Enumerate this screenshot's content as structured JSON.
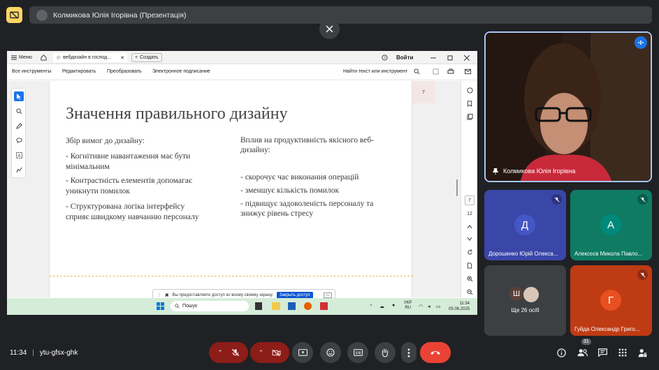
{
  "topbar": {
    "presenter_title": "Колмикова Юлія Ігорівна (Презентація)"
  },
  "colors": {
    "bg": "#202124",
    "accent": "#fdd663",
    "end_call": "#ea4335",
    "slide_text": "#3a3a3a"
  },
  "browser": {
    "menu_label": "Меню",
    "tab_label": "вебдизайн в господ...",
    "new_tab_label": "Создать",
    "login_label": "Войти"
  },
  "pdf_toolbar": {
    "items": [
      "Все инструменты",
      "Редактировать",
      "Преобразовать",
      "Электронное подписание"
    ],
    "search_label": "Найти текст или инструмент"
  },
  "slide": {
    "title": "Значення правильного дизайну",
    "left_heading": "Збір вимог до дизайну:",
    "left_items": [
      [
        "- Когнітивне навантаження має бути",
        "мінімальним"
      ],
      [
        "- Контрастність елементів допомагає",
        "уникнути помилок"
      ],
      [
        "- Структурована логіка інтерфейсу",
        "сприяє швидкому навчанню персоналу"
      ]
    ],
    "right_heading": [
      "Вплив на продуктивність якісного веб-",
      "дизайну:"
    ],
    "right_items": [
      [
        "- скорочує час виконання операцій"
      ],
      [
        "- зменшує кількість помилок"
      ],
      [
        "- підвищує задоволеність персоналу та",
        "знижує рівень стресу"
      ]
    ]
  },
  "pdf_nav": {
    "page_thumb": "7",
    "current_page": "7",
    "total_pages": "12"
  },
  "share_notice": {
    "text": "Вы предоставляете доступ ко всему своему экрану.",
    "button": "Закрыть доступ"
  },
  "taskbar": {
    "search": "Пошук",
    "lang1": "УКР",
    "lang2": "RU",
    "time": "11:34",
    "date": "05.06.2025"
  },
  "participants": [
    {
      "name": "Колмикова Юлія Ігорівна"
    },
    {
      "name": "Дорошенко Юрій Олекса...",
      "initial": "Д",
      "tile_color": "#3a46a8",
      "avatar_color": "#4556c5"
    },
    {
      "name": "Алексєєв Микола Павло...",
      "initial": "А",
      "tile_color": "#0f7b63",
      "avatar_color": "#00897b"
    },
    {
      "name": "Гуйда Олександр Григо...",
      "initial": "Г",
      "tile_color": "#bf3b14",
      "avatar_color": "#e8501f"
    }
  ],
  "others": {
    "label": "Ще 26 осіб",
    "initial": "Ш"
  },
  "bottom": {
    "time": "11:34",
    "meeting_code": "ytu-gfsx-ghk",
    "people_count": "31"
  }
}
